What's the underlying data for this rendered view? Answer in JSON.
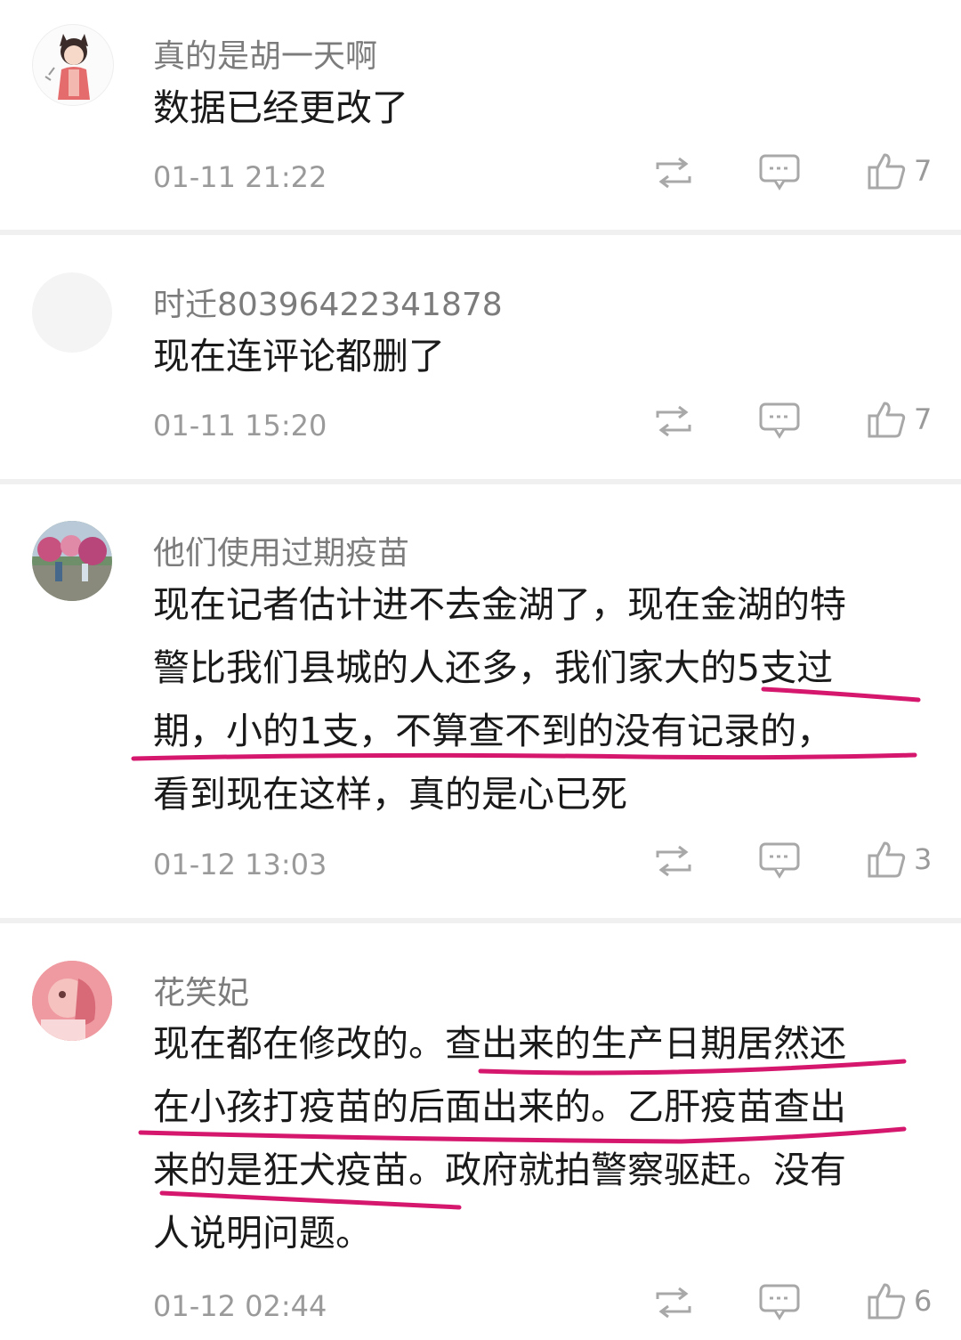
{
  "comments": [
    {
      "username": "真的是胡一天啊",
      "lines": [
        "数据已经更改了"
      ],
      "time": "01-11 21:22",
      "likes": "7"
    },
    {
      "username": "时迁80396422341878",
      "lines": [
        "现在连评论都删了"
      ],
      "time": "01-11 15:20",
      "likes": "7"
    },
    {
      "username": "他们使用过期疫苗",
      "lines": [
        "现在记者估计进不去金湖了，现在金湖的特",
        "警比我们县城的人还多，我们家大的5支过",
        "期，小的1支，不算查不到的没有记录的，",
        "看到现在这样，真的是心已死"
      ],
      "time": "01-12 13:03",
      "likes": "3"
    },
    {
      "username": "花笑妃",
      "lines": [
        "现在都在修改的。查出来的生产日期居然还",
        "在小孩打疫苗的后面出来的。乙肝疫苗查出",
        "来的是狂犬疫苗。政府就拍警察驱赶。没有",
        "人说明问题。"
      ],
      "time": "01-12 02:44",
      "likes": "6"
    }
  ],
  "icons": {
    "repost": "repost-icon",
    "reply": "comment-bubble-icon",
    "like": "thumbs-up-icon"
  },
  "colors": {
    "highlight": "#d6176e",
    "meta": "#9a9a9a",
    "text": "#1a1a1a",
    "divider": "#f0f0f0"
  }
}
